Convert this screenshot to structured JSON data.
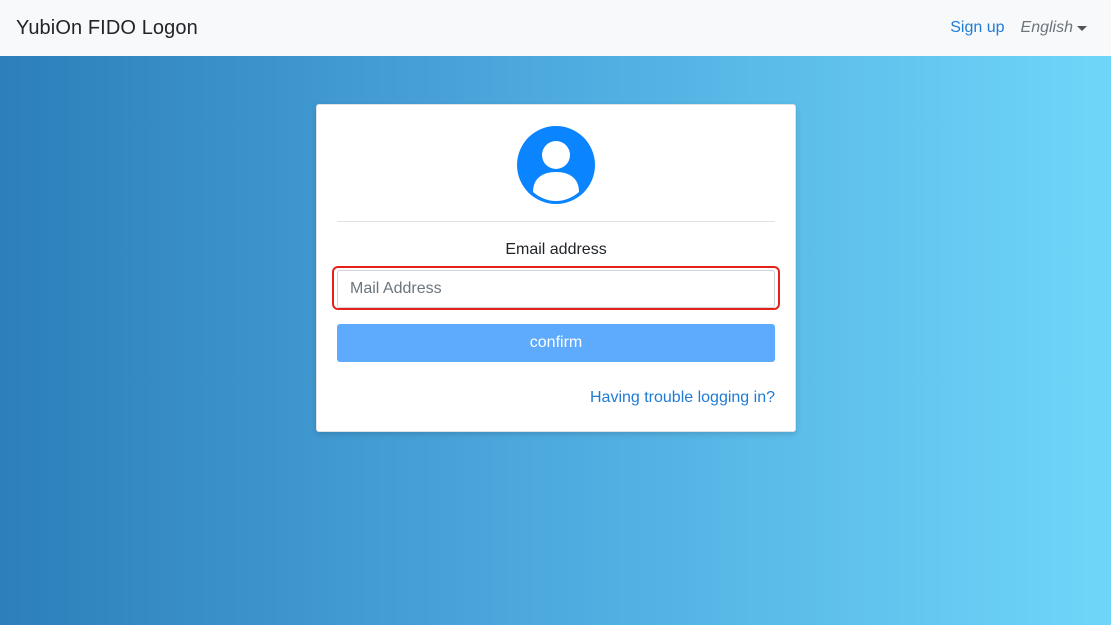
{
  "navbar": {
    "brand": "YubiOn FIDO Logon",
    "signup_label": "Sign up",
    "language_label": "English"
  },
  "login_card": {
    "avatar_icon": "user-circle-icon",
    "email_label": "Email address",
    "email_placeholder": "Mail Address",
    "email_value": "",
    "confirm_label": "confirm",
    "trouble_link": "Having trouble logging in?"
  },
  "colors": {
    "accent": "#1e7bd6",
    "avatar": "#0a84ff",
    "button": "#5eaafc",
    "highlight": "#e5211c",
    "gradient_start": "#2c7fba",
    "gradient_end": "#6fd6f9"
  }
}
